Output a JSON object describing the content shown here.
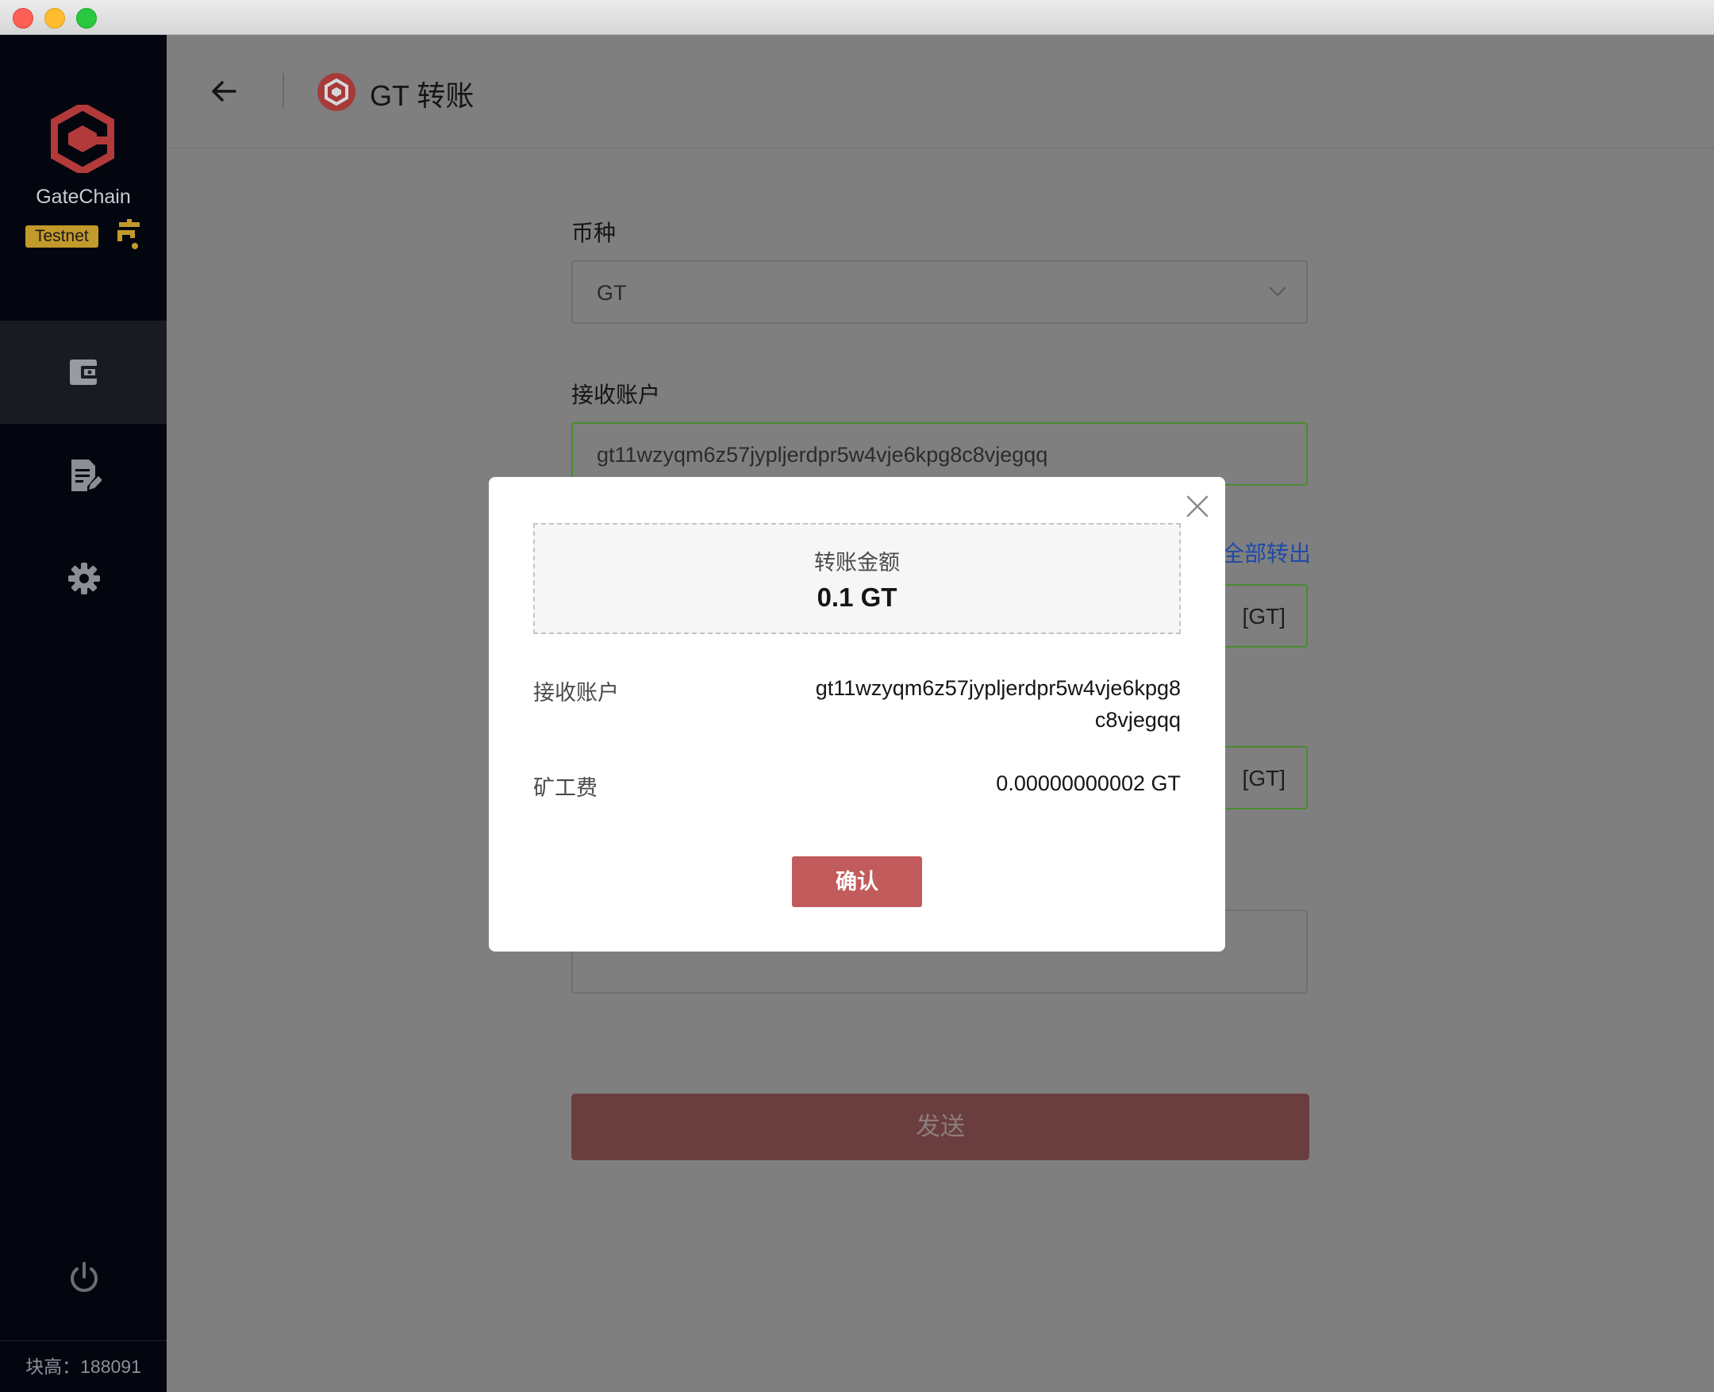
{
  "sidebar": {
    "brand_name": "GateChain",
    "network_badge": "Testnet",
    "nav_icons": [
      "wallet-icon",
      "document-edit-icon",
      "gear-icon"
    ],
    "power_icon": "power-icon",
    "block_height": "块高：188091"
  },
  "header": {
    "title": "GT 转账"
  },
  "form": {
    "currency_label": "币种",
    "currency_value": "GT",
    "recipient_label": "接收账户",
    "recipient_value": "gt11wzyqm6z57jypljerdpr5w4vje6kpg8c8vjegqq",
    "all_out_link": "全部转出",
    "amount_unit": "[GT]",
    "fee_unit": "[GT]",
    "send_label": "发送"
  },
  "modal": {
    "amount_label": "转账金额",
    "amount_value": "0.1 GT",
    "recipient_label": "接收账户",
    "recipient_line1": "gt11wzyqm6z57jypljerdpr5w4vje6kpg8",
    "recipient_line2": "c8vjegqq",
    "fee_label": "矿工费",
    "fee_value": "0.00000000002 GT",
    "confirm_label": "确认"
  },
  "colors": {
    "accent_red": "#c25b5b",
    "brand_red": "#b23a3a",
    "sidebar_bg": "#03060f",
    "badge_gold": "#c29a2b",
    "link_blue": "#1e4ba8",
    "valid_green": "#4a8a2f"
  }
}
